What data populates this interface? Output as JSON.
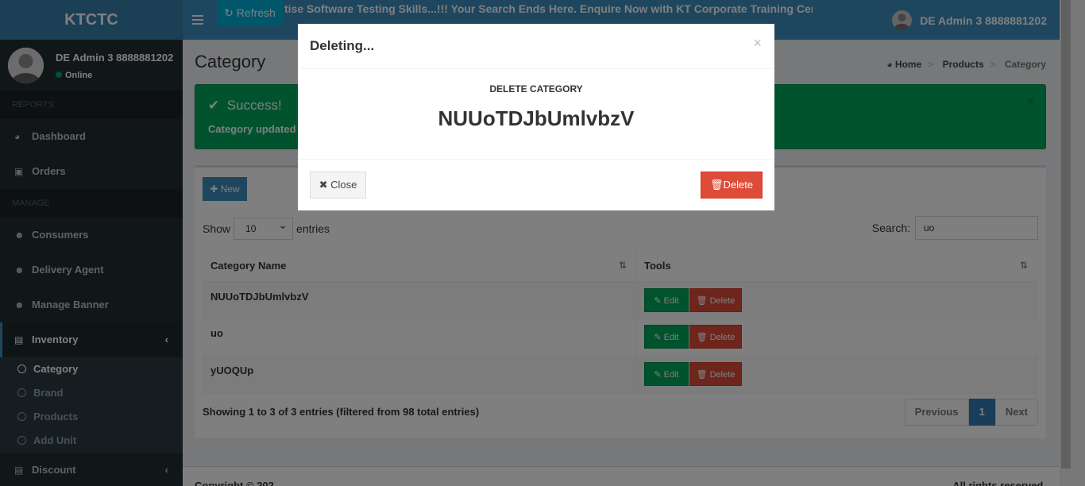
{
  "header": {
    "logo": "KTCTC",
    "refresh_label": "Refresh",
    "marquee": "tise Software Testing Skills...!!! Your Search Ends Here. Enquire Now with KT Corporate Training Centre for c",
    "user_name": "DE Admin 3 8888881202"
  },
  "sidebar": {
    "user_name": "DE Admin 3 8888881202",
    "status": "Online",
    "sections": {
      "reports": "REPORTS",
      "manage": "MANAGE"
    },
    "items": {
      "dashboard": "Dashboard",
      "orders": "Orders",
      "consumers": "Consumers",
      "delivery_agent": "Delivery Agent",
      "manage_banner": "Manage Banner",
      "inventory": "Inventory",
      "discount": "Discount"
    },
    "inventory_sub": {
      "category": "Category",
      "brand": "Brand",
      "products": "Products",
      "add_unit": "Add Unit"
    }
  },
  "page": {
    "title": "Category",
    "breadcrumb": [
      "Home",
      "Products",
      "Category"
    ]
  },
  "alert": {
    "title": "Success!",
    "message": "Category updated s"
  },
  "table_box": {
    "new_label": "New",
    "show_label": "Show",
    "entries_label": "entries",
    "page_size": "10",
    "search_label": "Search:",
    "search_value": "uo",
    "columns": [
      "Category Name",
      "Tools"
    ],
    "rows": [
      {
        "name": "NUUoTDJbUmlvbzV"
      },
      {
        "name": "uo"
      },
      {
        "name": "yUOQUp"
      }
    ],
    "edit_label": "Edit",
    "delete_label": "Delete",
    "info": "Showing 1 to 3 of 3 entries (filtered from 98 total entries)",
    "pagination": {
      "previous": "Previous",
      "current": "1",
      "next": "Next"
    }
  },
  "footer": {
    "left": "Copyright © 202",
    "right": "All rights reserved."
  },
  "modal": {
    "title": "Deleting...",
    "close_x": "×",
    "subtitle": "DELETE CATEGORY",
    "item_name": "NUUoTDJbUmlvbzV",
    "close_label": "Close",
    "delete_label": "Delete"
  },
  "colors": {
    "navbar": "#3c8dbc",
    "sidebar": "#222d32",
    "success": "#00a65a",
    "danger": "#dd4b39"
  }
}
